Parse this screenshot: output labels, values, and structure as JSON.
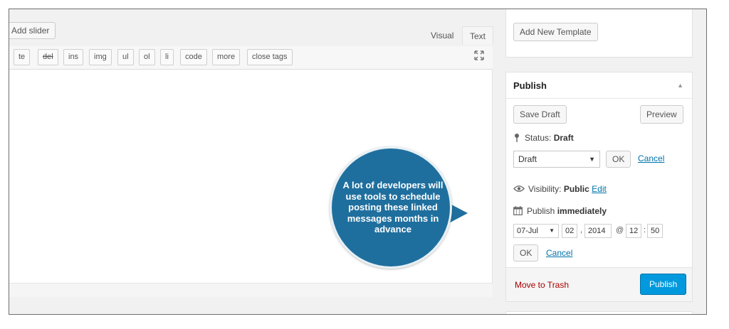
{
  "editor": {
    "add_slider_label": "Add slider",
    "tabs": [
      {
        "label": "Visual"
      },
      {
        "label": "Text"
      }
    ],
    "quicktags": [
      "te",
      "del",
      "ins",
      "img",
      "ul",
      "ol",
      "li",
      "code",
      "more",
      "close tags"
    ],
    "fullscreen_icon": "expand-icon"
  },
  "templates": {
    "add_new_label": "Add New Template"
  },
  "publish": {
    "title": "Publish",
    "save_draft_label": "Save Draft",
    "preview_label": "Preview",
    "status_label": "Status:",
    "status_value": "Draft",
    "status_select_value": "Draft",
    "ok_label": "OK",
    "cancel_label": "Cancel",
    "visibility_label": "Visibility:",
    "visibility_value": "Public",
    "edit_label": "Edit",
    "publish_label": "Publish",
    "publish_when": "immediately",
    "date": {
      "month": "07-Jul",
      "day": "02",
      "year": "2014",
      "at": "@",
      "hour": "12",
      "minute": "50",
      "comma": ",",
      "colon": ":"
    },
    "date_ok_label": "OK",
    "date_cancel_label": "Cancel",
    "move_to_trash_label": "Move to Trash",
    "publish_button_label": "Publish"
  },
  "callout": {
    "text": "A lot of developers will use tools to schedule posting these linked messages months in advance",
    "color": "#1f6f9e"
  }
}
